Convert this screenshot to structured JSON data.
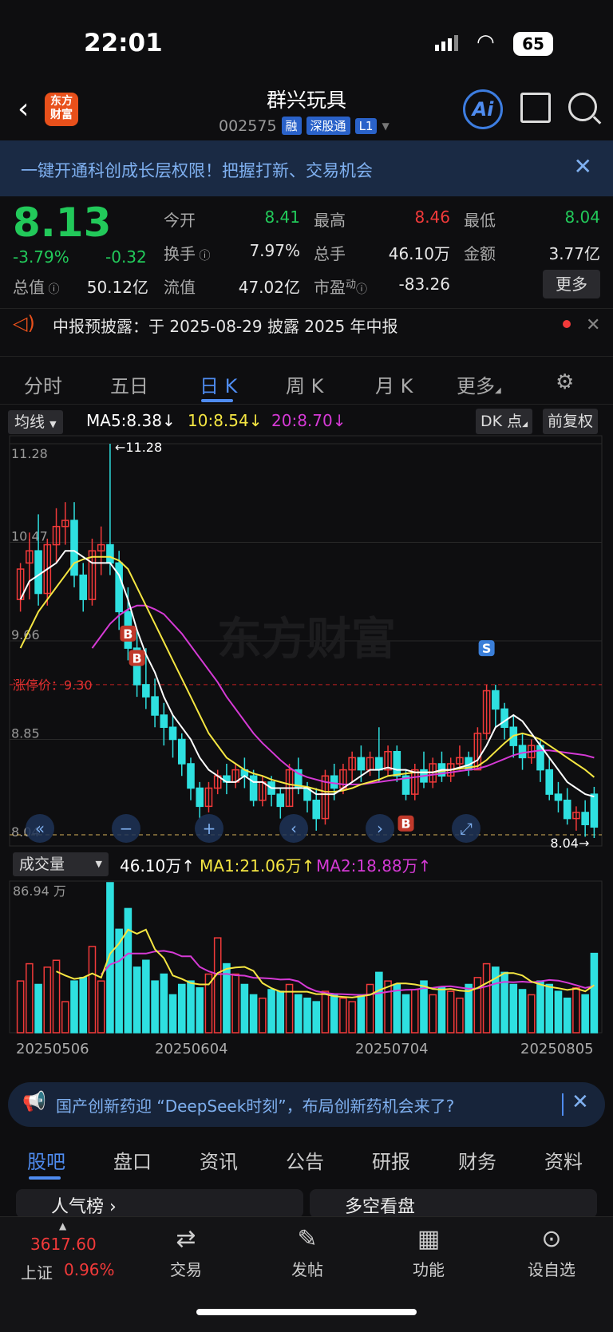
{
  "status": {
    "time": "22:01",
    "battery": "65"
  },
  "header": {
    "logo_text": "东方\n财富",
    "name": "群兴玩具",
    "code": "002575",
    "tags": [
      "融",
      "深股通",
      "L1"
    ],
    "ai_label": "Ai"
  },
  "banner": {
    "text": "一键开通科创成长层权限！把握打新、交易机会"
  },
  "quote": {
    "price": "8.13",
    "change_pct": "-3.79%",
    "change_amt": "-0.32",
    "fields": [
      {
        "label": "今开",
        "value": "8.41"
      },
      {
        "label": "最高",
        "value": "8.46"
      },
      {
        "label": "最低",
        "value": "8.04"
      },
      {
        "label": "换手",
        "value": "7.97%"
      },
      {
        "label": "总手",
        "value": "46.10万"
      },
      {
        "label": "金额",
        "value": "3.77亿"
      },
      {
        "label": "总值",
        "value": "50.12亿"
      },
      {
        "label": "流值",
        "value": "47.02亿"
      },
      {
        "label": "市盈",
        "sup": "动",
        "value": "-83.26"
      }
    ],
    "more": "更多"
  },
  "notice": {
    "text": "中报预披露：于 2025-08-29 披露 2025 年中报"
  },
  "tabs": [
    "分时",
    "五日",
    "日 K",
    "周 K",
    "月 K",
    "更多"
  ],
  "indicators": {
    "selector": "均线",
    "ma5": "MA5:8.38",
    "ma10": "10:8.54",
    "ma20": "20:8.70",
    "dk": "DK 点",
    "adjust": "前复权",
    "vol_selector": "成交量",
    "vol": "46.10万",
    "vol_ma1": "MA1:21.06万",
    "vol_ma2": "MA2:18.88万"
  },
  "colors": {
    "up": "#f23a3a",
    "down": "#2ee0e0",
    "ma5": "#ffffff",
    "ma10": "#f5e642",
    "ma20": "#d53ad5",
    "accent": "#4f8cf0"
  },
  "chart_data": {
    "type": "candlestick",
    "y_ticks": [
      "11.28",
      "10.47",
      "9.66",
      "8.85",
      "8.04"
    ],
    "ylim": [
      8.04,
      11.28
    ],
    "limit_label": "涨停价：9.30",
    "limit_price": 9.3,
    "high_label": "←11.28",
    "low_label": "8.04→",
    "vol_max_label": "86.94 万",
    "x_labels": [
      "20250506",
      "20250604",
      "20250704",
      "20250805"
    ],
    "ohlc": [
      [
        10.0,
        10.3,
        10.25,
        9.9
      ],
      [
        10.3,
        10.55,
        10.4,
        10.0
      ],
      [
        10.4,
        10.7,
        10.05,
        9.95
      ],
      [
        10.05,
        10.5,
        10.45,
        9.95
      ],
      [
        10.45,
        10.75,
        10.6,
        10.3
      ],
      [
        10.6,
        10.8,
        10.65,
        10.45
      ],
      [
        10.65,
        10.8,
        10.2,
        10.1
      ],
      [
        10.2,
        10.3,
        10.0,
        9.9
      ],
      [
        10.0,
        10.5,
        10.4,
        9.95
      ],
      [
        10.4,
        10.6,
        10.45,
        10.2
      ],
      [
        10.45,
        11.28,
        10.3,
        10.2
      ],
      [
        10.3,
        10.4,
        9.9,
        9.75
      ],
      [
        9.9,
        10.1,
        9.6,
        9.5
      ],
      [
        9.6,
        9.75,
        9.3,
        9.2
      ],
      [
        9.3,
        9.6,
        9.2,
        9.1
      ],
      [
        9.2,
        9.35,
        9.05,
        8.95
      ],
      [
        9.05,
        9.15,
        8.95,
        8.8
      ],
      [
        8.95,
        9.05,
        8.85,
        8.7
      ],
      [
        8.85,
        8.9,
        8.65,
        8.55
      ],
      [
        8.65,
        8.7,
        8.45,
        8.35
      ],
      [
        8.45,
        8.5,
        8.3,
        8.2
      ],
      [
        8.3,
        8.5,
        8.45,
        8.25
      ],
      [
        8.45,
        8.6,
        8.55,
        8.4
      ],
      [
        8.55,
        8.65,
        8.5,
        8.4
      ],
      [
        8.5,
        8.65,
        8.6,
        8.45
      ],
      [
        8.6,
        8.7,
        8.55,
        8.45
      ],
      [
        8.55,
        8.6,
        8.35,
        8.3
      ],
      [
        8.35,
        8.55,
        8.5,
        8.3
      ],
      [
        8.5,
        8.55,
        8.4,
        8.3
      ],
      [
        8.4,
        8.45,
        8.3,
        8.2
      ],
      [
        8.3,
        8.65,
        8.6,
        8.3
      ],
      [
        8.6,
        8.7,
        8.45,
        8.4
      ],
      [
        8.45,
        8.5,
        8.35,
        8.25
      ],
      [
        8.35,
        8.45,
        8.2,
        8.1
      ],
      [
        8.2,
        8.6,
        8.55,
        8.15
      ],
      [
        8.55,
        8.65,
        8.45,
        8.35
      ],
      [
        8.45,
        8.65,
        8.6,
        8.4
      ],
      [
        8.6,
        8.75,
        8.7,
        8.5
      ],
      [
        8.7,
        8.8,
        8.6,
        8.5
      ],
      [
        8.6,
        8.75,
        8.7,
        8.55
      ],
      [
        8.7,
        8.95,
        8.6,
        8.5
      ],
      [
        8.6,
        8.8,
        8.75,
        8.55
      ],
      [
        8.75,
        8.8,
        8.55,
        8.5
      ],
      [
        8.55,
        8.6,
        8.4,
        8.35
      ],
      [
        8.4,
        8.65,
        8.6,
        8.35
      ],
      [
        8.6,
        8.75,
        8.5,
        8.45
      ],
      [
        8.5,
        8.7,
        8.65,
        8.45
      ],
      [
        8.65,
        8.75,
        8.55,
        8.5
      ],
      [
        8.55,
        8.7,
        8.65,
        8.5
      ],
      [
        8.65,
        8.8,
        8.7,
        8.6
      ],
      [
        8.7,
        8.75,
        8.6,
        8.55
      ],
      [
        8.6,
        8.95,
        8.9,
        8.6
      ],
      [
        8.9,
        9.3,
        9.25,
        8.85
      ],
      [
        9.25,
        9.3,
        9.1,
        8.95
      ],
      [
        9.1,
        9.15,
        8.95,
        8.85
      ],
      [
        8.95,
        9.05,
        8.8,
        8.7
      ],
      [
        8.8,
        8.9,
        8.7,
        8.6
      ],
      [
        8.7,
        8.85,
        8.8,
        8.65
      ],
      [
        8.8,
        8.85,
        8.6,
        8.5
      ],
      [
        8.6,
        8.7,
        8.4,
        8.35
      ],
      [
        8.4,
        8.5,
        8.35,
        8.25
      ],
      [
        8.35,
        8.45,
        8.2,
        8.15
      ],
      [
        8.2,
        8.3,
        8.25,
        8.1
      ],
      [
        8.25,
        8.35,
        8.15,
        8.05
      ],
      [
        8.4,
        8.46,
        8.13,
        8.04
      ]
    ],
    "ma5": [
      10.0,
      10.15,
      10.2,
      10.25,
      10.3,
      10.4,
      10.4,
      10.35,
      10.3,
      10.3,
      10.3,
      10.2,
      10.0,
      9.75,
      9.55,
      9.4,
      9.2,
      9.05,
      8.95,
      8.85,
      8.7,
      8.6,
      8.55,
      8.5,
      8.5,
      8.55,
      8.5,
      8.5,
      8.45,
      8.45,
      8.45,
      8.45,
      8.45,
      8.4,
      8.4,
      8.4,
      8.45,
      8.5,
      8.55,
      8.6,
      8.6,
      8.62,
      8.6,
      8.6,
      8.58,
      8.58,
      8.58,
      8.6,
      8.6,
      8.62,
      8.64,
      8.68,
      8.8,
      8.95,
      9.0,
      9.05,
      9.0,
      8.9,
      8.8,
      8.7,
      8.6,
      8.5,
      8.45,
      8.4,
      8.38
    ],
    "ma10": [
      9.6,
      9.75,
      9.9,
      10.0,
      10.1,
      10.2,
      10.3,
      10.33,
      10.35,
      10.35,
      10.35,
      10.32,
      10.25,
      10.1,
      9.95,
      9.8,
      9.65,
      9.5,
      9.35,
      9.2,
      9.05,
      8.9,
      8.8,
      8.7,
      8.65,
      8.6,
      8.57,
      8.55,
      8.52,
      8.5,
      8.48,
      8.47,
      8.46,
      8.44,
      8.42,
      8.42,
      8.43,
      8.45,
      8.48,
      8.5,
      8.52,
      8.55,
      8.56,
      8.57,
      8.58,
      8.58,
      8.58,
      8.59,
      8.6,
      8.61,
      8.62,
      8.63,
      8.68,
      8.75,
      8.82,
      8.88,
      8.9,
      8.88,
      8.85,
      8.8,
      8.75,
      8.7,
      8.65,
      8.6,
      8.54
    ],
    "ma20": [
      null,
      null,
      null,
      null,
      null,
      null,
      null,
      null,
      9.6,
      9.7,
      9.8,
      9.87,
      9.92,
      9.95,
      9.95,
      9.92,
      9.88,
      9.8,
      9.72,
      9.62,
      9.52,
      9.42,
      9.32,
      9.2,
      9.1,
      9.0,
      8.9,
      8.82,
      8.75,
      8.68,
      8.62,
      8.57,
      8.54,
      8.52,
      8.5,
      8.49,
      8.48,
      8.48,
      8.48,
      8.49,
      8.5,
      8.51,
      8.52,
      8.53,
      8.54,
      8.55,
      8.56,
      8.57,
      8.58,
      8.59,
      8.6,
      8.61,
      8.63,
      8.66,
      8.69,
      8.72,
      8.74,
      8.75,
      8.76,
      8.76,
      8.75,
      8.74,
      8.73,
      8.72,
      8.7
    ],
    "volume": [
      30,
      40,
      28,
      38,
      42,
      18,
      30,
      32,
      50,
      30,
      87,
      60,
      72,
      38,
      42,
      30,
      34,
      22,
      28,
      30,
      26,
      34,
      55,
      40,
      34,
      28,
      22,
      20,
      25,
      24,
      28,
      22,
      20,
      18,
      24,
      22,
      20,
      18,
      22,
      28,
      35,
      30,
      28,
      22,
      25,
      30,
      22,
      26,
      24,
      20,
      28,
      32,
      40,
      38,
      35,
      28,
      25,
      22,
      30,
      28,
      24,
      20,
      26,
      22,
      46
    ]
  },
  "chart_markers": {
    "buy": "B",
    "sell": "S",
    "nav_icons": [
      "«",
      "−",
      "+",
      "‹",
      "›",
      "⤢"
    ]
  },
  "news": {
    "text": "国产创新药迎 “DeepSeek时刻”，布局创新药机会来了?"
  },
  "bottom_tabs": [
    "股吧",
    "盘口",
    "资讯",
    "公告",
    "研报",
    "财务",
    "资料"
  ],
  "cards": [
    "人气榜",
    "多空看盘"
  ],
  "footer": {
    "index_value": "3617.60",
    "index_name": "上证",
    "index_pct": "0.96%",
    "buttons": [
      {
        "label": "交易",
        "icon": "trade-icon"
      },
      {
        "label": "发帖",
        "icon": "post-icon"
      },
      {
        "label": "功能",
        "icon": "apps-icon"
      },
      {
        "label": "设自选",
        "icon": "watchlist-icon"
      }
    ]
  }
}
